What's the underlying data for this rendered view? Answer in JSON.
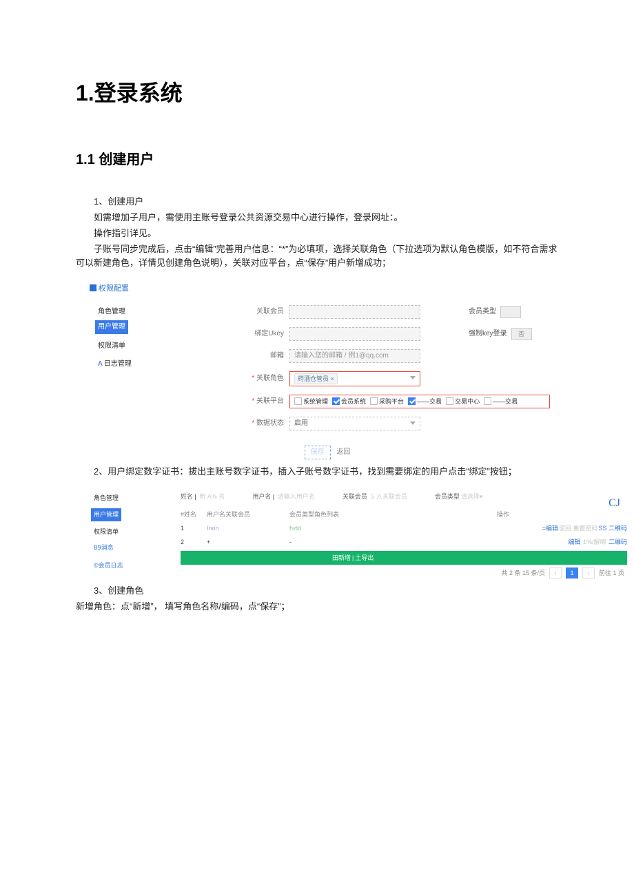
{
  "headings": {
    "h1": "1.登录系统",
    "h2": "1.1 创建用户"
  },
  "paragraphs": {
    "p1": "1、创建用户",
    "p2": "如需增加子用户，需使用主账号登录公共资源交易中心进行操作，登录网址：。",
    "p3": "操作指引详见。",
    "p4": "子账号同步完成后，点击“编辑”完善用户信息：“*”为必填项，选择关联角色（下拉选项为默认角色模版，如不符合需求可以新建角色，详情见创建角色说明），关联对应平台，点“保存”用户新增成功；",
    "p5": "2、用户绑定数字证书：拔出主账号数字证书，插入子账号数字证书，找到需要绑定的用户点击“绑定”按钮；",
    "p6": "3、创建角色",
    "p7": "新增角色：点“新增”， 填写角色名称/编码，点“保存”；"
  },
  "shot1": {
    "title": "权限配置",
    "nav": {
      "role_mgmt": "角色管理",
      "user_mgmt": "用户管理",
      "perm_list": "权限清单",
      "log_mgmt": "日志管理",
      "log_prefix": "A"
    },
    "form": {
      "assoc_member": {
        "label": "关联会员"
      },
      "member_type": {
        "label": "会员类型"
      },
      "bind_ukey": {
        "label": "绑定Ukey"
      },
      "force_key": {
        "label": "强制key登录",
        "value": "否"
      },
      "email": {
        "label": "邮箱",
        "placeholder": "请输入您的邮箱 / 例1@qq.com"
      },
      "assoc_role": {
        "label": "关联角色",
        "tag": "药酒仓管员 ×"
      },
      "assoc_platform": {
        "label": "关联平台",
        "opts": [
          {
            "text": "系统管理",
            "checked": false
          },
          {
            "text": "会员系统",
            "checked": true
          },
          {
            "text": "采购平台",
            "checked": false
          },
          {
            "text": "——交易",
            "checked": true
          },
          {
            "text": "交易中心",
            "checked": false
          },
          {
            "text": "——交易",
            "checked": false
          }
        ]
      },
      "data_status": {
        "label": "数据状态",
        "value": "启用"
      },
      "actions": {
        "save": "保存",
        "back": "返回"
      }
    }
  },
  "shot2": {
    "corner": "CJ",
    "nav": {
      "role_mgmt": "角色管理",
      "user_mgmt": "用户管理",
      "perm_list": "权限清单",
      "msg": "B9消息",
      "memlog": "©会员日志"
    },
    "filters": {
      "name": {
        "label": "姓名",
        "hint": "新 A% 名"
      },
      "username": {
        "label": "用户名",
        "hint": "请输入用户名"
      },
      "assoc_member": {
        "label": "关联会员",
        "hint": "S 入关联会员"
      },
      "member_type": {
        "label": "会员类型",
        "hint": "请选择▾"
      }
    },
    "table": {
      "headers": {
        "idx": "#姓名",
        "user": "用户名关联会员",
        "type": "会员类型角色列表",
        "ops": "操作"
      },
      "rows": [
        {
          "idx": "1",
          "user": "Inon",
          "type": "fsdd",
          "ops_edit": "=编辑",
          "ops_mid": "驳回 重置密码",
          "ops_tail": "SS 二维码"
        },
        {
          "idx": "2",
          "user": "+",
          "type": "-",
          "ops_edit": "编辑",
          "ops_mid": "1%/解绑",
          "ops_tail": "二维码"
        }
      ],
      "greenbar": {
        "add": "田新增",
        "export": "土导出"
      },
      "pager": {
        "total": "共 2 条 15 条/页",
        "p1": "‹",
        "p2": "1",
        "p3": "›",
        "goto": "前往 1 页"
      }
    }
  }
}
